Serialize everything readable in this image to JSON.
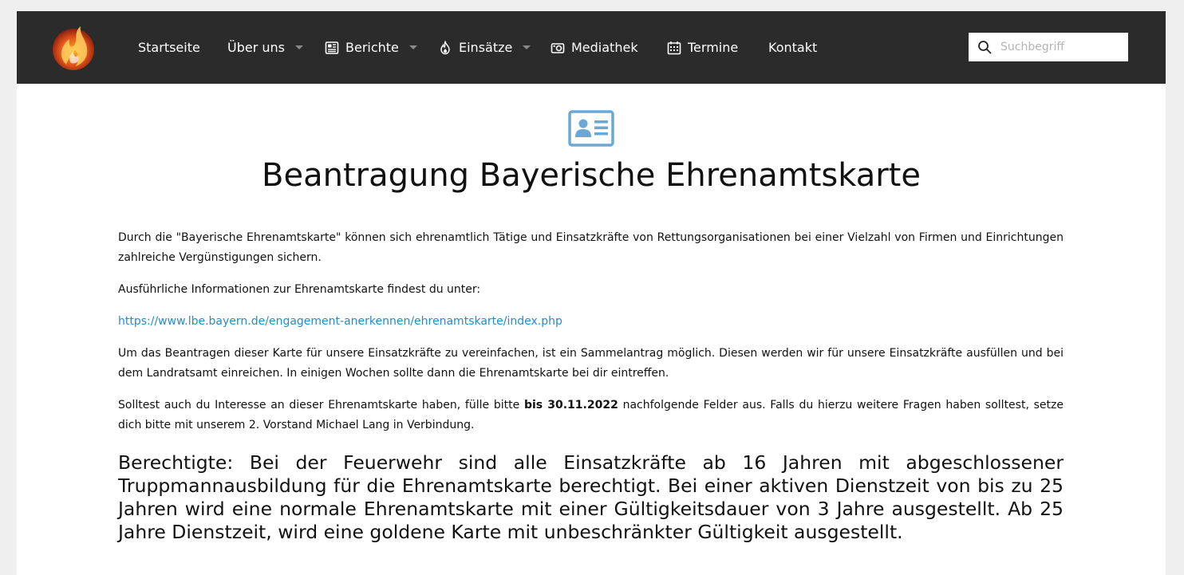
{
  "nav": {
    "items": [
      {
        "label": "Startseite"
      },
      {
        "label": "Über uns"
      },
      {
        "label": "Berichte"
      },
      {
        "label": "Einsätze"
      },
      {
        "label": "Mediathek"
      },
      {
        "label": "Termine"
      },
      {
        "label": "Kontakt"
      }
    ],
    "search_placeholder": "Suchbegriff"
  },
  "colors": {
    "navbar_bg": "#2b2b2b",
    "link": "#2a8ac5",
    "hero_icon": "#6aa8d6"
  },
  "icons": {
    "hero": "id-card-icon",
    "berichte": "newspaper-icon",
    "einsaetze": "fire-icon",
    "mediathek": "camera-icon",
    "termine": "calendar-icon",
    "search": "search-icon"
  },
  "page": {
    "title": "Beantragung Bayerische Ehrenamtskarte",
    "p1": "Durch die \"Bayerische Ehrenamtskarte\" können sich ehrenamtlich Tätige und Einsatzkräfte von Rettungsorganisationen bei einer Vielzahl von Firmen und Einrichtungen zahlreiche Vergünstigungen sichern.",
    "p2": "Ausführliche Informationen zur Ehrenamtskarte findest du unter:",
    "link": "https://www.lbe.bayern.de/engagement-anerkennen/ehrenamtskarte/index.php",
    "p3": "Um das Beantragen dieser Karte für unsere Einsatzkräfte zu vereinfachen, ist ein Sammelantrag möglich. Diesen werden wir für unsere Einsatzkräfte ausfüllen und bei dem Landratsamt einreichen. In einigen Wochen sollte dann die Ehrenamtskarte bei dir eintreffen.",
    "p4_before": "Solltest auch du Interesse an dieser Ehrenamtskarte haben, fülle bitte ",
    "p4_bold": "bis 30.11.2022",
    "p4_after": " nachfolgende Felder aus. Falls du hierzu weitere Fragen haben solltest, setze dich bitte mit unserem 2. Vorstand Michael Lang in Verbindung.",
    "p5": "Berechtigte: Bei der Feuerwehr sind alle Einsatzkräfte ab 16 Jahren mit abgeschlossener Truppmannausbildung für die Ehrenamtskarte berechtigt. Bei einer aktiven Dienstzeit von bis zu 25 Jahren wird eine normale Ehrenamtskarte mit einer Gültigkeitsdauer von 3 Jahre ausgestellt. Ab 25 Jahre Dienstzeit, wird eine goldene Karte mit unbeschränkter Gültigkeit ausgestellt."
  }
}
